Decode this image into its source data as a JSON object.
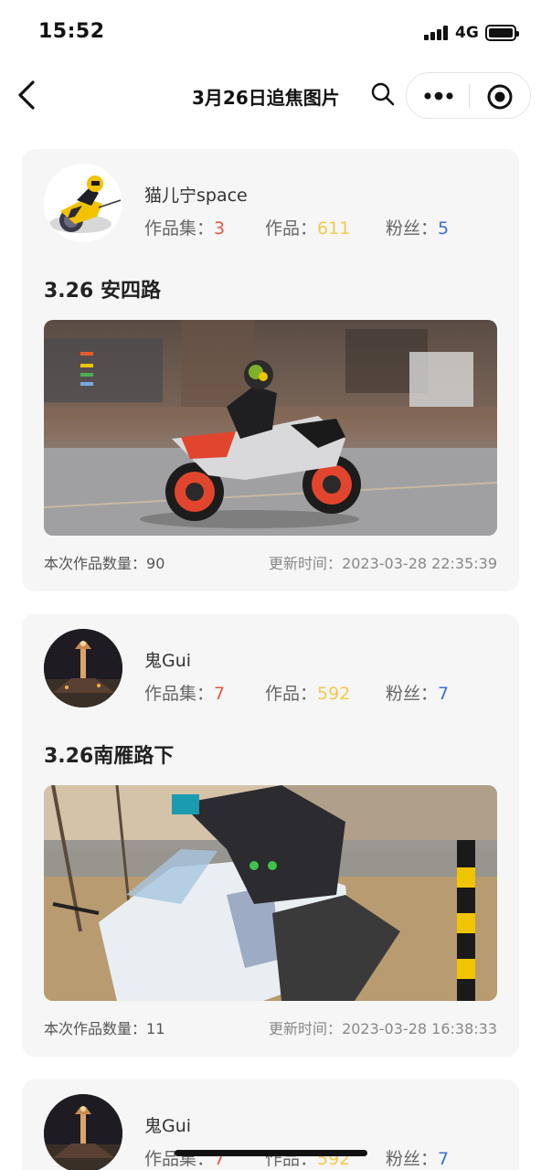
{
  "status_bar": {
    "time": "15:52",
    "network": "4G"
  },
  "nav": {
    "title": "3月26日追焦图片"
  },
  "labels": {
    "albums": "作品集：",
    "works": "作品：",
    "fans": "粉丝：",
    "count_prefix": "本次作品数量：",
    "updated_prefix": "更新时间："
  },
  "posts": [
    {
      "user": {
        "name": "猫儿宁space",
        "albums": "3",
        "works": "611",
        "fans": "5",
        "avatar_icon": "yellow-motorcycle-rider-icon"
      },
      "title": "3.26 安四路",
      "photo_icon": "motorcycle-photo",
      "count": "90",
      "updated": "2023-03-28 22:35:39"
    },
    {
      "user": {
        "name": "鬼Gui",
        "albums": "7",
        "works": "592",
        "fans": "7",
        "avatar_icon": "night-pagoda-icon"
      },
      "title": "3.26南雁路下",
      "photo_icon": "motorcycle-photo",
      "count": "11",
      "updated": "2023-03-28 16:38:33"
    },
    {
      "user": {
        "name": "鬼Gui",
        "albums": "7",
        "works": "592",
        "fans": "7",
        "avatar_icon": "night-pagoda-icon"
      }
    }
  ],
  "colors": {
    "albums_value": "#e8563f",
    "works_value": "#f2c94c",
    "fans_value": "#3a6fd8",
    "card_bg": "#f6f6f6"
  }
}
